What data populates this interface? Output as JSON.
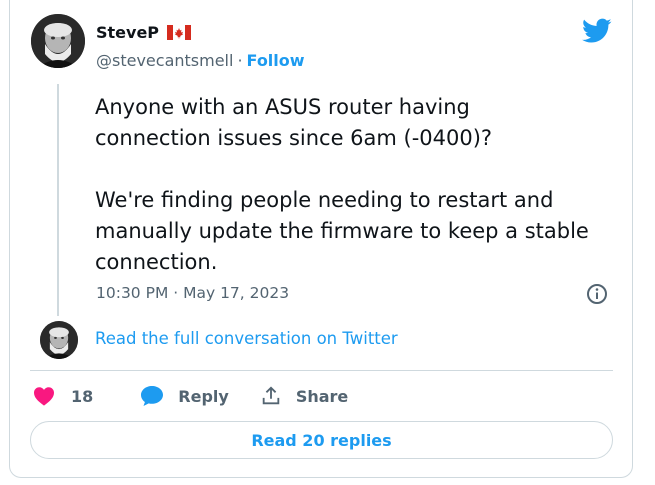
{
  "author": {
    "display_name": "SteveP",
    "flag_icon": "canada-flag-icon",
    "handle": "@stevecantsmell",
    "separator": "·",
    "follow_label": "Follow"
  },
  "brand": {
    "icon": "twitter-bird-icon",
    "color": "#1d9bf0"
  },
  "tweet": {
    "text": "Anyone with an ASUS router having\nconnection issues since 6am (-0400)?\n\nWe're finding people needing to restart and\nmanually update the firmware to keep a stable\nconnection.",
    "timestamp": "10:30 PM · May 17, 2023"
  },
  "conversation": {
    "read_full_label": "Read the full conversation on Twitter"
  },
  "actions": {
    "like_count": "18",
    "reply_label": "Reply",
    "share_label": "Share",
    "like_color": "#f91880"
  },
  "read_replies_label": "Read 20 replies"
}
